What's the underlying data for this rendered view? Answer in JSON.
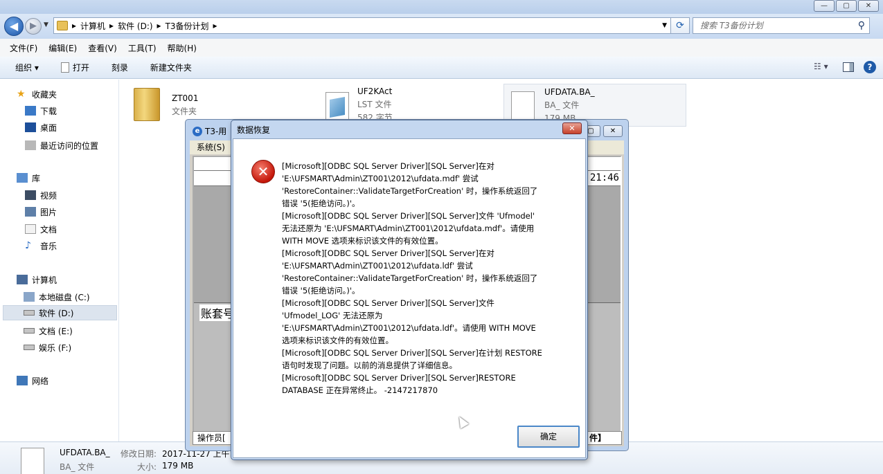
{
  "explorer": {
    "window_controls": {
      "minimize": "—",
      "maximize": "▢",
      "close": "✕"
    },
    "breadcrumb": [
      "计算机",
      "软件 (D:)",
      "T3备份计划"
    ],
    "search_placeholder": "搜索 T3备份计划",
    "menu": [
      "文件(F)",
      "编辑(E)",
      "查看(V)",
      "工具(T)",
      "帮助(H)"
    ],
    "commands": {
      "organize": "组织 ▾",
      "open": "打开",
      "burn": "刻录",
      "new_folder": "新建文件夹"
    },
    "nav": {
      "favorites": "收藏夹",
      "downloads": "下载",
      "desktop": "桌面",
      "recent": "最近访问的位置",
      "libraries": "库",
      "videos": "视频",
      "pictures": "图片",
      "documents": "文档",
      "music": "音乐",
      "computer": "计算机",
      "drive_c": "本地磁盘 (C:)",
      "drive_d": "软件 (D:)",
      "drive_e": "文档 (E:)",
      "drive_f": "娱乐 (F:)",
      "network": "网络"
    },
    "files": [
      {
        "name": "ZT001",
        "type": "文件夹"
      },
      {
        "name": "UF2KAct",
        "type": "LST 文件",
        "size": "582 字节"
      },
      {
        "name": "UFDATA.BA_",
        "type": "BA_ 文件",
        "size": "179 MB"
      }
    ],
    "details": {
      "name": "UFDATA.BA_",
      "modified_label": "修改日期:",
      "modified_value": "2017-11-27 上午",
      "type": "BA_ 文件",
      "size_label": "大小:",
      "size_value": "179 MB"
    }
  },
  "t3": {
    "title": "T3-用",
    "menu": "系统(S)",
    "time": "21:46",
    "account_label": "账套号",
    "status_left": "操作员[",
    "status_right": "件】"
  },
  "dialog": {
    "title": "数据恢复",
    "close": "✕",
    "lines": [
      "[Microsoft][ODBC SQL Server Driver][SQL Server]在对",
      "'E:\\UFSMART\\Admin\\ZT001\\2012\\ufdata.mdf' 尝试",
      "'RestoreContainer::ValidateTargetForCreation' 时，操作系统返回了",
      "错误 '5(拒绝访问。)'。",
      "[Microsoft][ODBC SQL Server Driver][SQL Server]文件 'Ufmodel'",
      "无法还原为 'E:\\UFSMART\\Admin\\ZT001\\2012\\ufdata.mdf'。请使用",
      "WITH MOVE 选项来标识该文件的有效位置。",
      "[Microsoft][ODBC SQL Server Driver][SQL Server]在对",
      "'E:\\UFSMART\\Admin\\ZT001\\2012\\ufdata.ldf' 尝试",
      "'RestoreContainer::ValidateTargetForCreation' 时，操作系统返回了",
      "错误 '5(拒绝访问。)'。",
      "[Microsoft][ODBC SQL Server Driver][SQL Server]文件",
      "'Ufmodel_LOG' 无法还原为",
      "'E:\\UFSMART\\Admin\\ZT001\\2012\\ufdata.ldf'。请使用 WITH MOVE",
      "选项来标识该文件的有效位置。",
      "[Microsoft][ODBC SQL Server Driver][SQL Server]在计划 RESTORE",
      "语句时发现了问题。以前的消息提供了详细信息。",
      "[Microsoft][ODBC SQL Server Driver][SQL Server]RESTORE",
      "DATABASE 正在异常终止。 -2147217870"
    ],
    "ok": "确定"
  }
}
